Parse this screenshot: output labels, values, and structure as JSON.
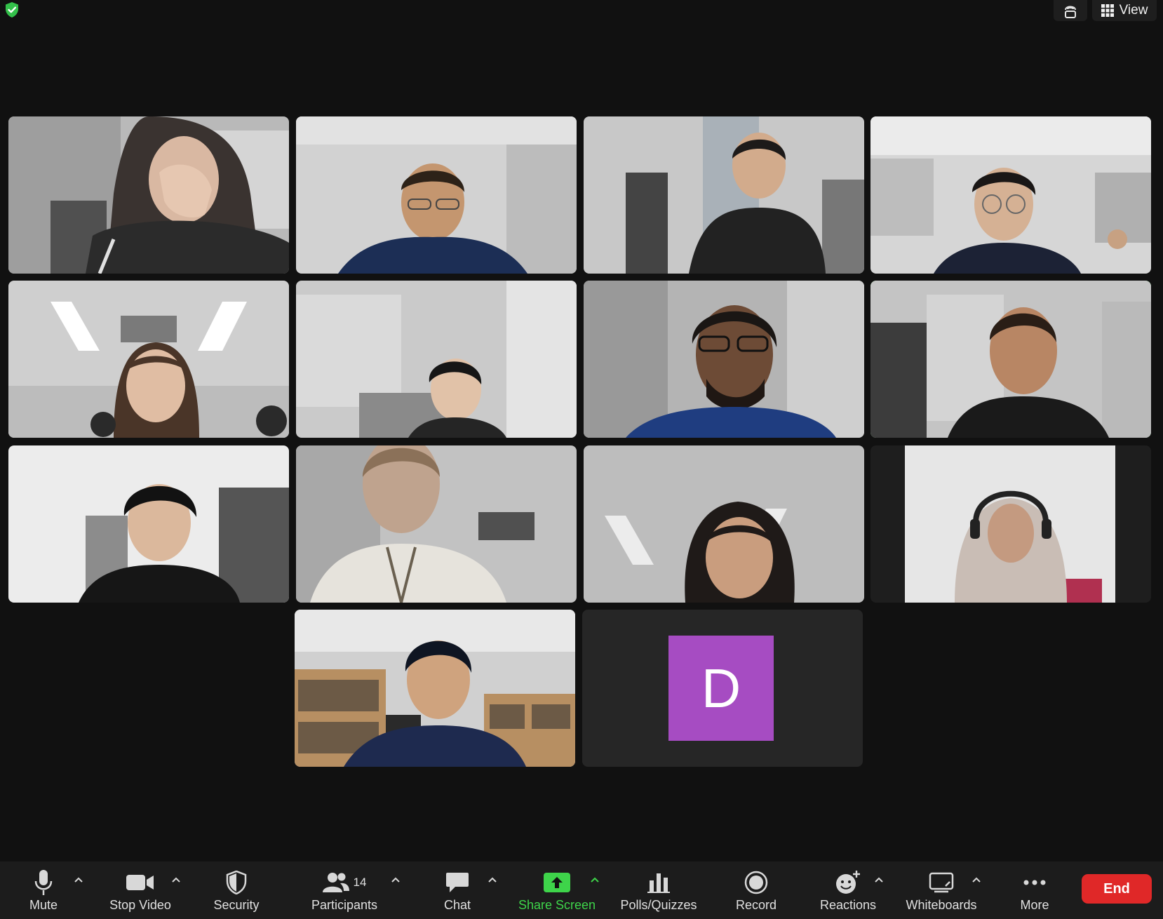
{
  "top_bar": {
    "view_label": "View"
  },
  "participants": [
    {
      "tile": 1,
      "state": "video"
    },
    {
      "tile": 2,
      "state": "video"
    },
    {
      "tile": 3,
      "state": "video"
    },
    {
      "tile": 4,
      "state": "video"
    },
    {
      "tile": 5,
      "state": "video"
    },
    {
      "tile": 6,
      "state": "video"
    },
    {
      "tile": 7,
      "state": "video"
    },
    {
      "tile": 8,
      "state": "video",
      "active_speaker": true
    },
    {
      "tile": 9,
      "state": "video"
    },
    {
      "tile": 10,
      "state": "video"
    },
    {
      "tile": 11,
      "state": "video"
    },
    {
      "tile": 12,
      "state": "video"
    },
    {
      "tile": 13,
      "state": "video"
    },
    {
      "tile": 14,
      "state": "avatar",
      "initial": "D",
      "avatar_color": "#a64cc2"
    }
  ],
  "toolbar": {
    "mute": "Mute",
    "stop_video": "Stop Video",
    "security": "Security",
    "participants": "Participants",
    "participants_count": "14",
    "chat": "Chat",
    "share_screen": "Share Screen",
    "polls": "Polls/Quizzes",
    "record": "Record",
    "reactions": "Reactions",
    "whiteboards": "Whiteboards",
    "more": "More",
    "end": "End"
  },
  "colors": {
    "background": "#111111",
    "toolbar": "#1c1c1c",
    "active_speaker_border": "#3fd14a",
    "share_green": "#3ed44a",
    "end_red": "#e02828"
  },
  "icons": [
    "shield-check-icon",
    "immersive-icon",
    "grid-icon",
    "microphone-icon",
    "camera-icon",
    "shield-icon",
    "participants-icon",
    "chat-icon",
    "share-arrow-icon",
    "polls-icon",
    "record-icon",
    "reactions-icon",
    "whiteboard-icon",
    "more-icon",
    "caret-up-icon"
  ]
}
